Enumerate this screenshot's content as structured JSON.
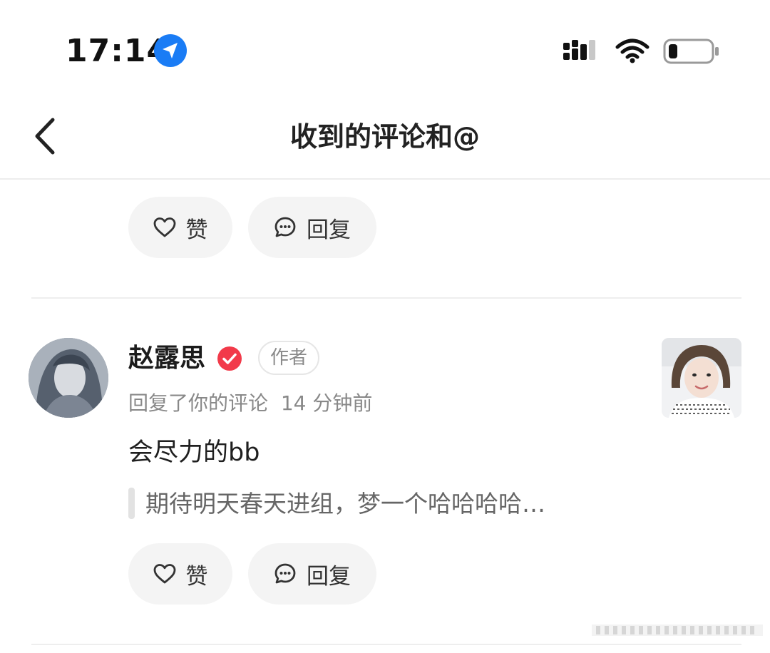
{
  "status_bar": {
    "time": "17:14",
    "icons": [
      "location-arrow-icon",
      "signal-icon",
      "wifi-icon",
      "battery-icon"
    ]
  },
  "nav": {
    "title": "收到的评论和@",
    "back_icon": "chevron-left-icon"
  },
  "top_actions": {
    "like_label": "赞",
    "reply_label": "回复"
  },
  "comment": {
    "username": "赵露思",
    "author_tag": "作者",
    "action_text": "回复了你的评论",
    "time_ago": "14 分钟前",
    "content": "会尽力的bb",
    "quoted": "期待明天春天进组，梦一个哈哈哈哈…",
    "like_label": "赞",
    "reply_label": "回复"
  },
  "colors": {
    "location_blue": "#1a7cf5",
    "verified_red": "#f23a4a",
    "pill_bg": "#f4f4f4"
  }
}
